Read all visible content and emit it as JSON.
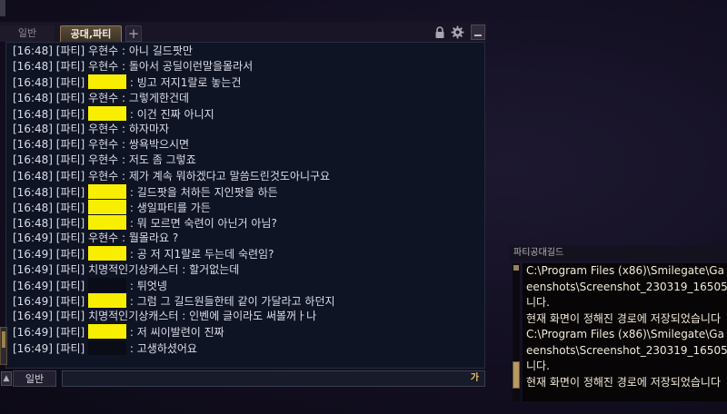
{
  "tabs": {
    "general": "일반",
    "party": "공대,파티",
    "add": "+"
  },
  "icons": {
    "lock": "lock-icon",
    "settings": "gear-icon",
    "minimize": "minimize-icon"
  },
  "messages": [
    {
      "time": "[16:48]",
      "channel": "[파티]",
      "sender": "우현수",
      "mask": "",
      "text": " : 아니 길드팟만"
    },
    {
      "time": "[16:48]",
      "channel": "[파티]",
      "sender": "우현수",
      "mask": "",
      "text": " : 돌아서 공딜이런말을몰라서"
    },
    {
      "time": "[16:48]",
      "channel": "[파티]",
      "sender": "",
      "mask": "yellow",
      "text": " : 빙고 저지1랄로 놓는건"
    },
    {
      "time": "[16:48]",
      "channel": "[파티]",
      "sender": "우현수",
      "mask": "",
      "text": " : 그렇게한건데"
    },
    {
      "time": "[16:48]",
      "channel": "[파티]",
      "sender": "",
      "mask": "yellow",
      "text": " : 이건 진짜 아니지"
    },
    {
      "time": "[16:48]",
      "channel": "[파티]",
      "sender": "우현수",
      "mask": "",
      "text": " : 하자마자"
    },
    {
      "time": "[16:48]",
      "channel": "[파티]",
      "sender": "우현수",
      "mask": "",
      "text": " : 쌍욕박으시면"
    },
    {
      "time": "[16:48]",
      "channel": "[파티]",
      "sender": "우현수",
      "mask": "",
      "text": " : 저도 좀 그렇죠"
    },
    {
      "time": "[16:48]",
      "channel": "[파티]",
      "sender": "우현수",
      "mask": "",
      "text": " : 제가 계속 뭐하겠다고 말씀드린것도아니구요"
    },
    {
      "time": "[16:48]",
      "channel": "[파티]",
      "sender": "",
      "mask": "yellow",
      "text": " : 길드팟을 처하든 지인팟을 하든"
    },
    {
      "time": "[16:48]",
      "channel": "[파티]",
      "sender": "",
      "mask": "yellow",
      "text": " : 생일파티를 가든"
    },
    {
      "time": "[16:48]",
      "channel": "[파티]",
      "sender": "",
      "mask": "yellow",
      "text": " : 뭐 모르면 숙련이 아닌거 아님?"
    },
    {
      "time": "[16:49]",
      "channel": "[파티]",
      "sender": "우현수",
      "mask": "",
      "text": " : 뭘몰라요 ?"
    },
    {
      "time": "[16:49]",
      "channel": "[파티]",
      "sender": "",
      "mask": "yellow",
      "text": " : 공 저 지1랄로 두는데 숙련임?"
    },
    {
      "time": "[16:49]",
      "channel": "[파티]",
      "sender": "치명적인기상캐스터",
      "mask": "",
      "text": " : 할거없는데"
    },
    {
      "time": "[16:49]",
      "channel": "[파티]",
      "sender": "",
      "mask": "black",
      "text": " : 튀엇넹"
    },
    {
      "time": "[16:49]",
      "channel": "[파티]",
      "sender": "",
      "mask": "yellow",
      "text": " : 그럼 그 길드원들한테 같이 가달라고 하던지"
    },
    {
      "time": "[16:49]",
      "channel": "[파티]",
      "sender": "치명적인기상캐스터",
      "mask": "",
      "text": " : 인벤에 글이라도 써볼꺼ㅏ나"
    },
    {
      "time": "[16:49]",
      "channel": "[파티]",
      "sender": "",
      "mask": "yellow",
      "text": " : 저 씨이발련이 진짜"
    },
    {
      "time": "[16:49]",
      "channel": "[파티]",
      "sender": "",
      "mask": "black",
      "text": " : 고생하셨어요"
    }
  ],
  "input": {
    "channel": "일반",
    "value": "",
    "ime": "가"
  },
  "side_panel": {
    "title": "파티공대길드",
    "lines": [
      "C:\\Program Files (x86)\\Smilegate\\Ga",
      "eenshots\\Screenshot_230319_16505",
      "니다.",
      "현재 화면이 정해진 경로에 저장되었습니다",
      "C:\\Program Files (x86)\\Smilegate\\Ga",
      "eenshots\\Screenshot_230319_16505",
      "니다.",
      "현재 화면이 정해진 경로에 저장되었습니다"
    ]
  },
  "colors": {
    "chat_text": "#dcdce8",
    "redaction": "#f8ee00",
    "accent_gold": "#b89a62",
    "background": "#110d1e"
  }
}
